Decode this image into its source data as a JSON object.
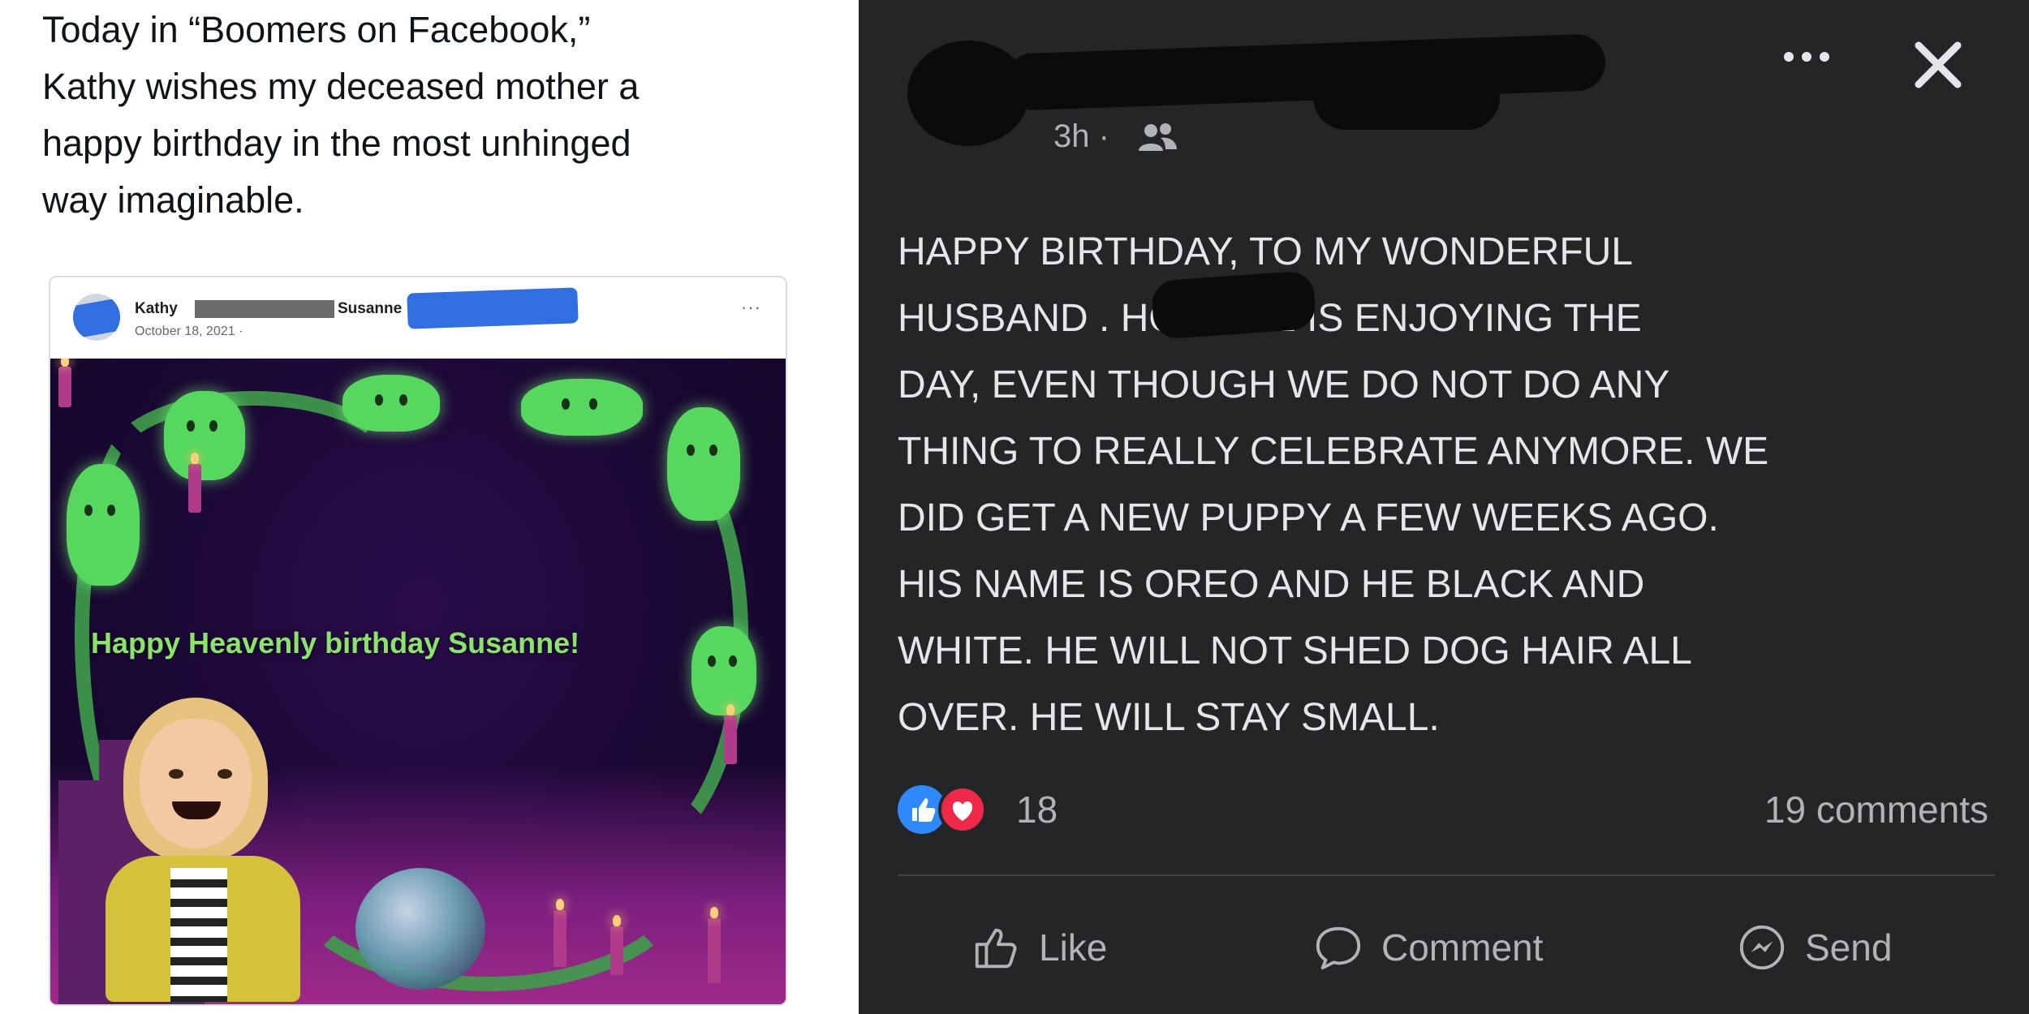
{
  "tweet": {
    "lines": [
      "Today in “Boomers on Facebook,”",
      "Kathy wishes my deceased mother a",
      "happy birthday in the most unhinged",
      "way imaginable."
    ]
  },
  "embedded_post": {
    "author": "Kathy",
    "recipient": "Susanne",
    "date": "October 18, 2021 · ",
    "more": "···",
    "greeting": "Happy Heavenly birthday Susanne!"
  },
  "facebook_post": {
    "time": "3h ·",
    "body_lines": [
      "HAPPY BIRTHDAY, TO MY WONDERFUL",
      "HUSBAND                  . HOPE HE IS ENJOYING THE",
      "DAY, EVEN THOUGH WE DO NOT DO ANY",
      "THING TO REALLY CELEBRATE ANYMORE. WE",
      "DID GET A NEW PUPPY A FEW WEEKS AGO.",
      "HIS NAME IS OREO AND HE BLACK AND",
      "WHITE. HE WILL NOT SHED DOG HAIR ALL",
      "OVER. HE WILL STAY SMALL."
    ],
    "reaction_count": "18",
    "comment_count": "19 comments",
    "actions": {
      "like": "Like",
      "comment": "Comment",
      "send": "Send"
    }
  },
  "colors": {
    "fb_dark_bg": "#242526",
    "fb_text": "#e4e6eb",
    "fb_secondary": "#b0b3b8",
    "like_blue": "#2e89ff",
    "love_red": "#f0284a",
    "ghost_green": "#56d85f"
  }
}
